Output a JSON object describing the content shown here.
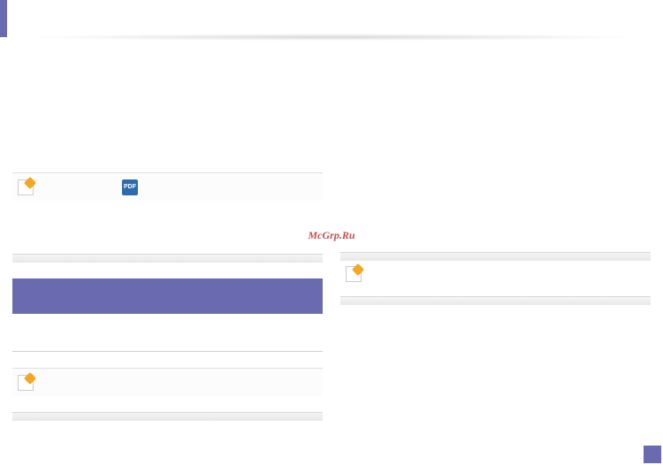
{
  "brand": "McGrp.Ru",
  "icons": {
    "note": "note-icon",
    "pdf": "pdf-icon"
  },
  "pdf_label": "PDF"
}
